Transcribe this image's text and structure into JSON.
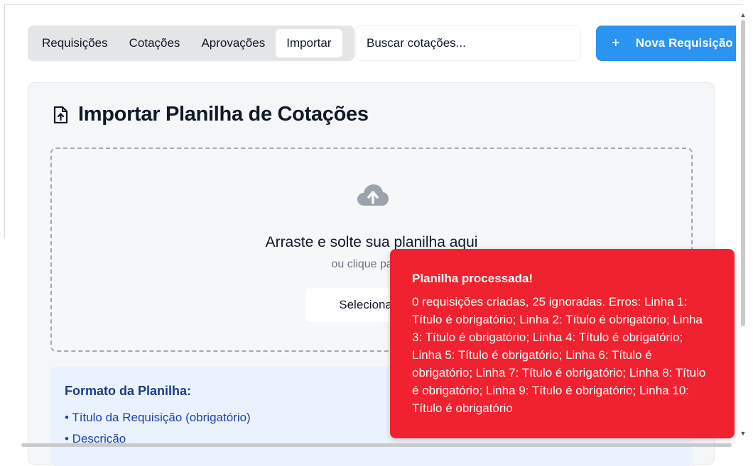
{
  "toolbar": {
    "tabs": [
      {
        "label": "Requisições",
        "active": false
      },
      {
        "label": "Cotações",
        "active": false
      },
      {
        "label": "Aprovações",
        "active": false
      },
      {
        "label": "Importar",
        "active": true
      }
    ],
    "search": {
      "placeholder": "Buscar cotações..."
    },
    "new_button": {
      "icon": "plus-icon",
      "label": "Nova Requisição"
    }
  },
  "import_card": {
    "icon": "file-upload-icon",
    "title": "Importar Planilha de Cotações",
    "dropzone": {
      "icon": "cloud-upload-icon",
      "heading": "Arraste e solte sua planilha aqui",
      "subtext": "ou clique para s",
      "button_label": "Selecionar A"
    },
    "format": {
      "title": "Formato da Planilha:",
      "items": [
        "• Título da Requisição (obrigatório)",
        "• Descrição"
      ]
    }
  },
  "toast": {
    "title": "Planilha processada!",
    "message": "0 requisições criadas, 25 ignoradas. Erros: Linha 1: Título é obrigatório; Linha 2: Título é obrigatório; Linha 3: Título é obrigatório; Linha 4: Título é obrigatório; Linha 5: Título é obrigatório; Linha 6: Título é obrigatório; Linha 7: Título é obrigatório; Linha 8: Título é obrigatório; Linha 9: Título é obrigatório; Linha 10: Título é obrigatório"
  },
  "colors": {
    "primary": "#2b93f0",
    "toast_error": "#f1222f",
    "format_bg": "#eaf2fd",
    "format_text": "#1e40af"
  }
}
